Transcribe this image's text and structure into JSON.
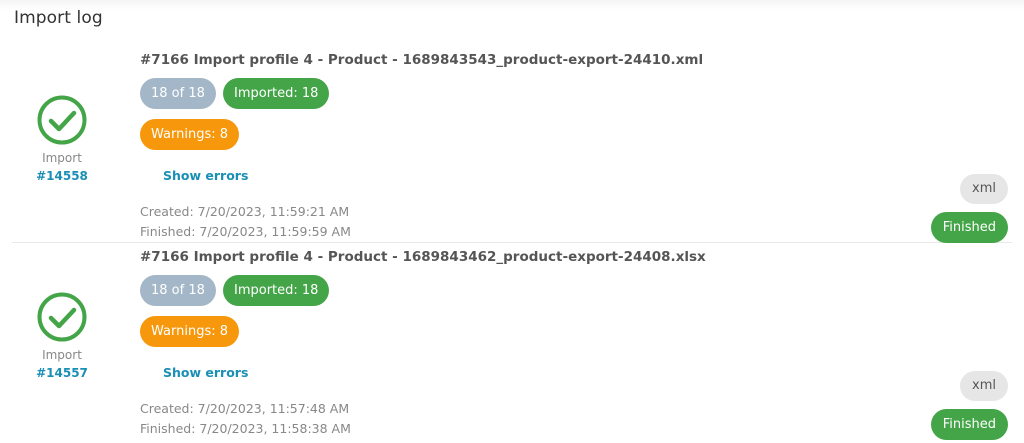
{
  "page": {
    "title": "Import log"
  },
  "colors": {
    "success": "#43a547",
    "warning": "#f7970b",
    "neutral": "#a4b7c8",
    "link": "#1a8fb5"
  },
  "imports": [
    {
      "title": "#7166 Import profile 4 - Product - 1689843543_product-export-24410.xml",
      "progress": "18 of 18",
      "imported": "Imported: 18",
      "warnings": "Warnings: 8",
      "show_errors": "Show errors",
      "created": "Created: 7/20/2023, 11:59:21 AM",
      "finished": "Finished: 7/20/2023, 11:59:59 AM",
      "import_label": "Import",
      "import_id": "#14558",
      "type": "xml",
      "status": "Finished",
      "status_icon": "check-circle-icon"
    },
    {
      "title": "#7166 Import profile 4 - Product - 1689843462_product-export-24408.xlsx",
      "progress": "18 of 18",
      "imported": "Imported: 18",
      "warnings": "Warnings: 8",
      "show_errors": "Show errors",
      "created": "Created: 7/20/2023, 11:57:48 AM",
      "finished": "Finished: 7/20/2023, 11:58:38 AM",
      "import_label": "Import",
      "import_id": "#14557",
      "type": "xml",
      "status": "Finished",
      "status_icon": "check-circle-icon"
    }
  ]
}
